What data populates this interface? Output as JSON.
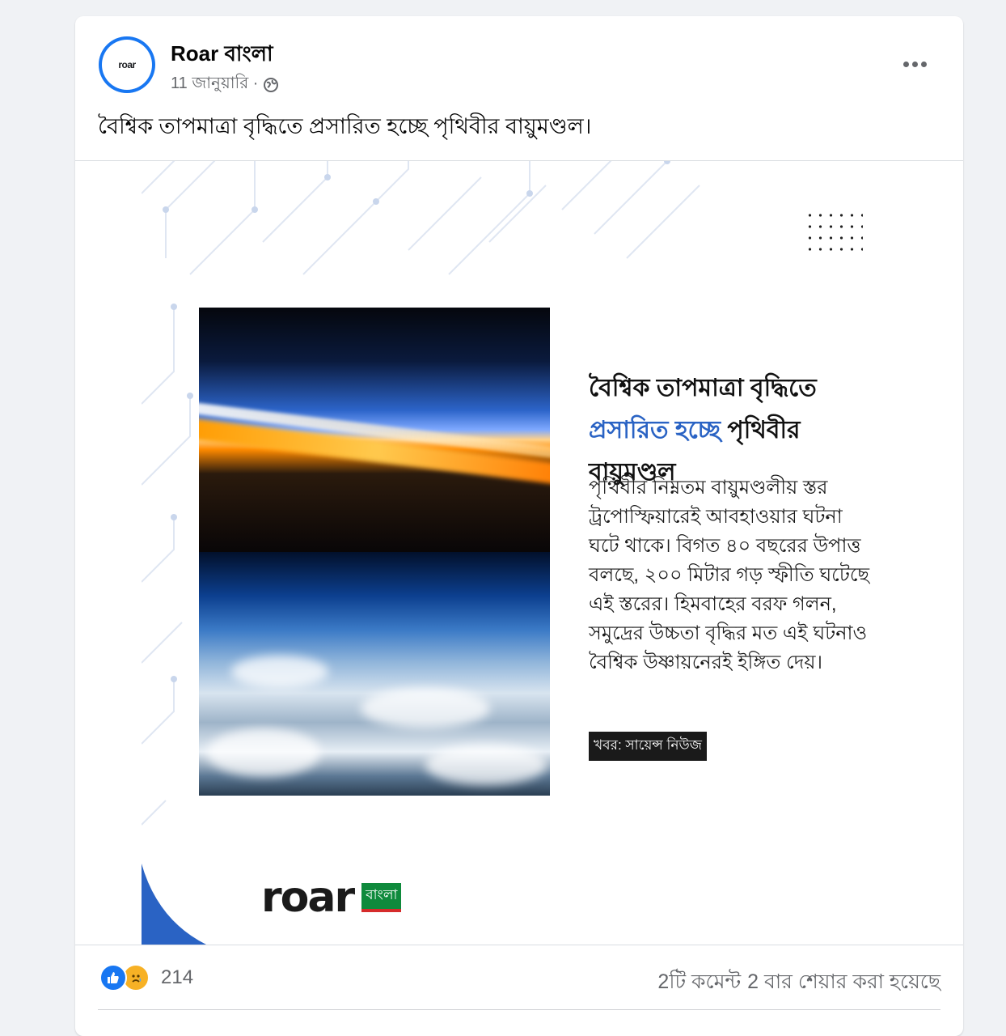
{
  "post": {
    "page_name": "Roar বাংলা",
    "date": "11 জানুয়ারি ·",
    "privacy_icon": "globe-icon",
    "caption": "বৈশ্বিক তাপমাত্রা বৃদ্ধিতে প্রসারিত হচ্ছে পৃথিবীর বায়ুমণ্ডল।",
    "more_icon": "more-horizontal-icon"
  },
  "avatar": {
    "word": "roar"
  },
  "poster": {
    "headline_part1": "বৈশ্বিক তাপমাত্রা বৃদ্ধিতে ",
    "headline_highlight": "প্রসারিত হচ্ছে",
    "headline_part2": " পৃথিবীর বায়ুমণ্ডল",
    "body": "পৃথিবীর নিম্নতম বায়ুমণ্ডলীয় স্তর ট্রপোস্ফিয়ারেই আবহাওয়ার ঘটনা ঘটে থাকে। বিগত ৪০ বছরের উপাত্ত বলছে, ২০০ মিটার গড় স্ফীতি ঘটেছে এই স্তরের। হিমবাহের বরফ গলন, সমুদ্রের উচ্চতা বৃদ্ধির মত এই ঘটনাও বৈশ্বিক উষ্ণায়নেরই ইঙ্গিত দেয়।",
    "source": "খবর: সায়েন্স নিউজ",
    "logo_word": "roar",
    "logo_tag": "বাংলা",
    "highlight_color": "#2a63c4"
  },
  "footer": {
    "reaction_count": "214",
    "like_icon": "thumbs-up-icon",
    "sad_icon": "sad-face-icon",
    "comments": "2টি কমেন্ট",
    "shares": "2 বার শেয়ার করা হয়েছে"
  }
}
